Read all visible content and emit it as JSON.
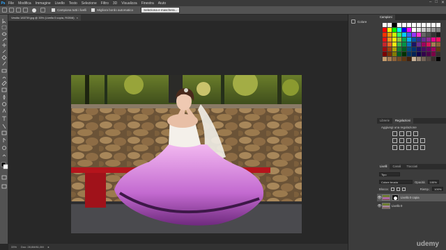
{
  "menu": {
    "logo": "Ps",
    "items": [
      "File",
      "Modifica",
      "Immagine",
      "Livello",
      "Testo",
      "Selezione",
      "Filtro",
      "3D",
      "Visualizza",
      "Finestra",
      "Aiuto"
    ],
    "window_controls": [
      "–",
      "□",
      "✕"
    ]
  },
  "options": {
    "sample_label": "Campiona tutti i livelli",
    "enhance_label": "Migliora bordo automatico",
    "refine_label": "Seleziona e maschera..."
  },
  "document": {
    "tab_label": "Vestito 183739.jpg @ 33% (Livello 0 copia, RGB/8)",
    "close": "×"
  },
  "status": {
    "zoom": "33%",
    "doc_size": "Doc: 28,6M/61,0M",
    "arrow": "▸"
  },
  "dock": {
    "color_label": "Colore"
  },
  "swatches_panel": {
    "tabs": [
      "Campioni"
    ],
    "colors": [
      [
        "#ffffff",
        "#ffffff",
        "#000000",
        "#ffffff",
        "#ffffff",
        "#ffffff",
        "#ffffff",
        "#ffffff",
        "#ffffff",
        "#ffffff",
        "#ffffff",
        "#ffffff"
      ],
      [
        "#ff0000",
        "#ffff00",
        "#00ff00",
        "#00ffff",
        "#0000ff",
        "#ff00ff",
        "#ffffff",
        "#e6e6e6",
        "#cccccc",
        "#b3b3b3",
        "#999999",
        "#808080"
      ],
      [
        "#ff3300",
        "#ff9900",
        "#ccff00",
        "#33ff66",
        "#00ccff",
        "#3366ff",
        "#9933ff",
        "#ff33cc",
        "#666666",
        "#4d4d4d",
        "#333333",
        "#1a1a1a"
      ],
      [
        "#ee1111",
        "#f7941d",
        "#fff200",
        "#8dc63f",
        "#00a651",
        "#00aeef",
        "#0054a6",
        "#2e3192",
        "#662d91",
        "#92278f",
        "#ec008c",
        "#ed145b"
      ],
      [
        "#c1272d",
        "#f26522",
        "#f7ec12",
        "#39b54a",
        "#009245",
        "#0072bc",
        "#1b1464",
        "#662d91",
        "#9e005d",
        "#d4145a",
        "#a67c52",
        "#8c6239"
      ],
      [
        "#9e0b0f",
        "#a0410d",
        "#aba000",
        "#197b30",
        "#005e20",
        "#004a80",
        "#003471",
        "#1b1464",
        "#440e62",
        "#630460",
        "#9e005d",
        "#603913"
      ],
      [
        "#790000",
        "#7b2e00",
        "#827b00",
        "#005e20",
        "#003300",
        "#003663",
        "#002157",
        "#0d004c",
        "#32004b",
        "#4b0049",
        "#7b0046",
        "#362f2d"
      ],
      [
        "#c69c6d",
        "#a67c52",
        "#8c6239",
        "#754c24",
        "#603913",
        "#42210b",
        "#c7b299",
        "#998675",
        "#736357",
        "#534741",
        "#362f2d",
        "#000000"
      ]
    ]
  },
  "adjustments": {
    "tabs": [
      "Librerie",
      "Regolazioni"
    ],
    "title": "Aggiungi una regolazione"
  },
  "layers": {
    "tabs": [
      "Livelli",
      "Canali",
      "Tracciati"
    ],
    "kind": "Tipo",
    "blend": "Colore brucia",
    "opacity_label": "Opacità:",
    "opacity": "100%",
    "lock_label": "Blocca:",
    "fill_label": "Riemp.:",
    "fill": "100%",
    "items": [
      {
        "name": "Livello 0 copia",
        "selected": true
      },
      {
        "name": "Livello 0",
        "selected": false
      }
    ]
  },
  "watermark": "udemy"
}
